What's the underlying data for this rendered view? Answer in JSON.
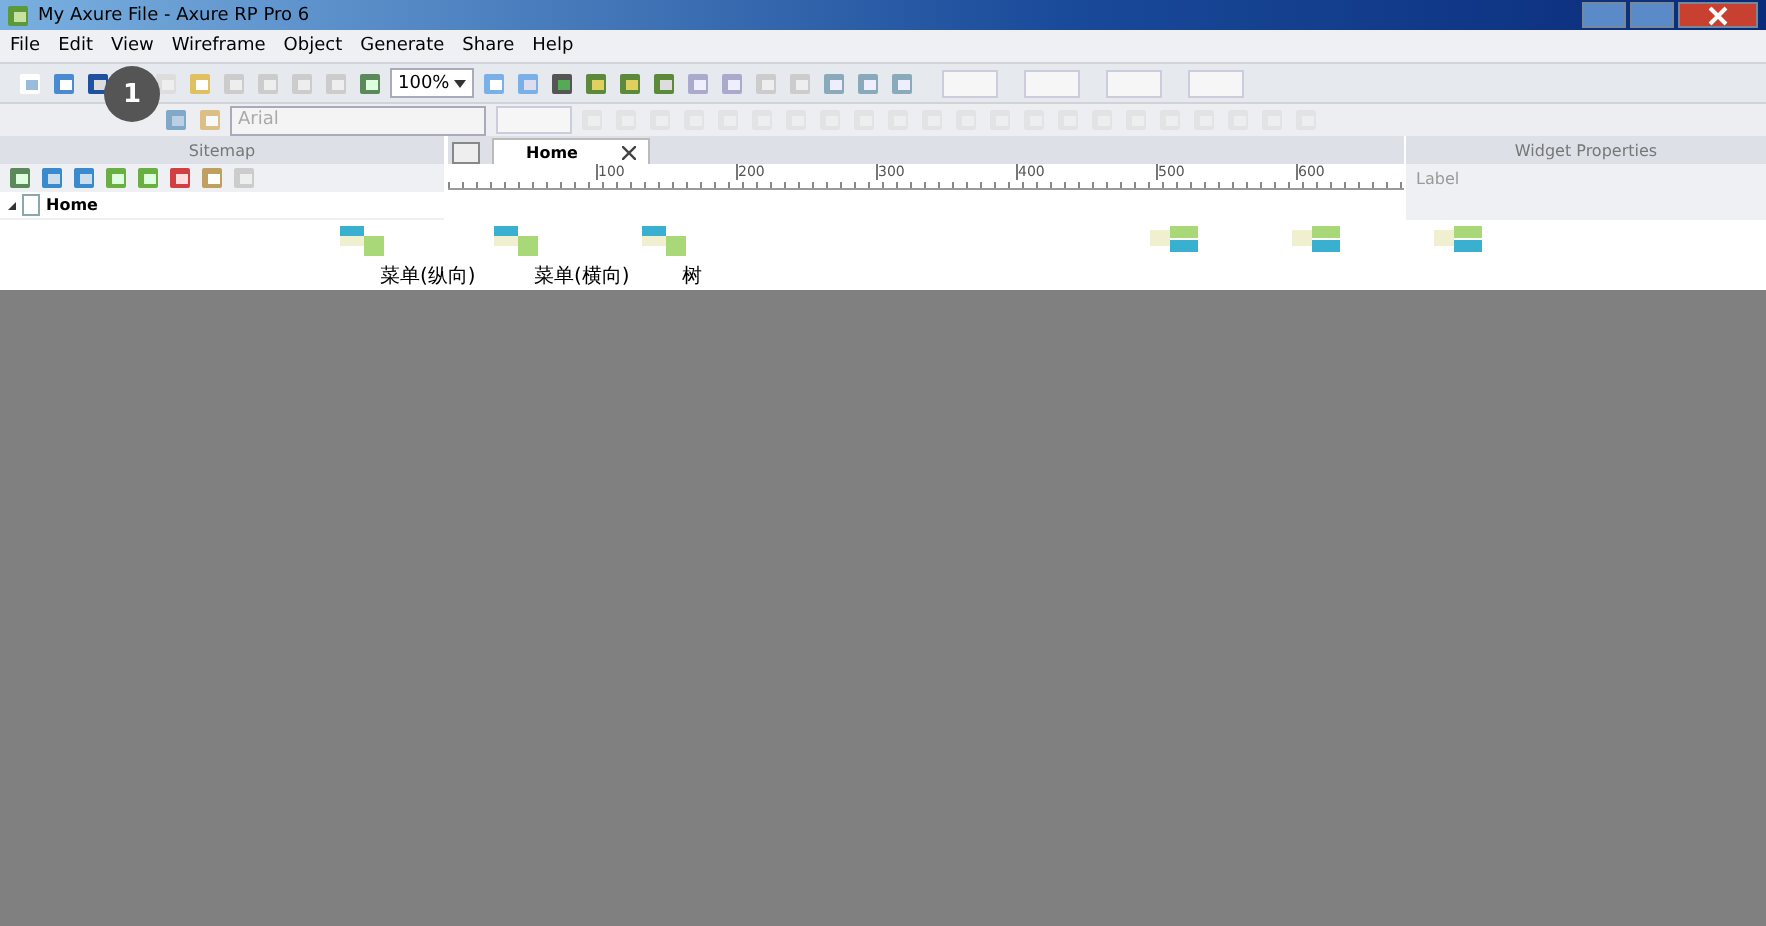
{
  "window": {
    "title": "My Axure File - Axure RP Pro 6"
  },
  "menu": [
    "File",
    "Edit",
    "View",
    "Wireframe",
    "Object",
    "Generate",
    "Share",
    "Help"
  ],
  "toolbar": {
    "zoom": "100%",
    "font": "Arial"
  },
  "step_badge": "1",
  "sitemap": {
    "title": "Sitemap",
    "pages": [
      {
        "label": "Home",
        "expanded": true
      }
    ]
  },
  "canvas": {
    "tabs": [
      {
        "label": "Home",
        "selected": true
      }
    ],
    "ruler": [
      "100",
      "200",
      "300",
      "400",
      "500",
      "600"
    ]
  },
  "widget_properties": {
    "title": "Widget Properties",
    "field": "Label"
  },
  "widgets": [
    {
      "label": "菜单(纵向)"
    },
    {
      "label": "菜单(横向)"
    },
    {
      "label": "树"
    }
  ]
}
